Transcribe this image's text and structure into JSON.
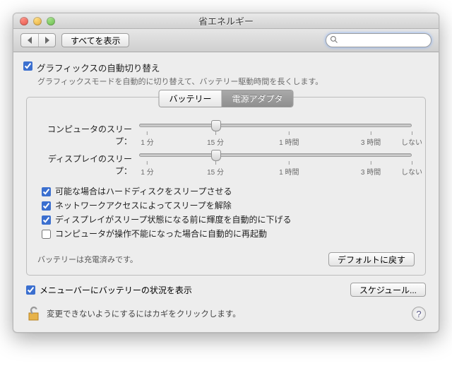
{
  "window": {
    "title": "省エネルギー"
  },
  "toolbar": {
    "show_all": "すべてを表示",
    "search_placeholder": ""
  },
  "graphics": {
    "checked": true,
    "title": "グラフィックスの自動切り替え",
    "subtitle": "グラフィックスモードを自動的に切り替えて、バッテリー駆動時間を長くします。"
  },
  "tabs": {
    "battery": "バッテリー",
    "power_adapter": "電源アダプタ",
    "active_index": 1
  },
  "sliders": {
    "computer": {
      "label": "コンピュータのスリープ：",
      "position_pct": 28
    },
    "display": {
      "label": "ディスプレイのスリープ：",
      "position_pct": 28
    },
    "ticks": [
      {
        "label": "1 分",
        "pct": 3
      },
      {
        "label": "15 分",
        "pct": 28
      },
      {
        "label": "1 時間",
        "pct": 55
      },
      {
        "label": "3 時間",
        "pct": 85
      },
      {
        "label": "しない",
        "pct": 100
      }
    ]
  },
  "options": {
    "hdd": {
      "checked": true,
      "label": "可能な場合はハードディスクをスリープさせる"
    },
    "network": {
      "checked": true,
      "label": "ネットワークアクセスによってスリープを解除"
    },
    "dim": {
      "checked": true,
      "label": "ディスプレイがスリープ状態になる前に輝度を自動的に下げる"
    },
    "restart": {
      "checked": false,
      "label": "コンピュータが操作不能になった場合に自動的に再起動"
    }
  },
  "status": {
    "battery": "バッテリーは充電済みです。"
  },
  "buttons": {
    "defaults": "デフォルトに戻す",
    "schedule": "スケジュール..."
  },
  "menubar": {
    "checked": true,
    "label": "メニューバーにバッテリーの状況を表示"
  },
  "lock": {
    "text": "変更できないようにするにはカギをクリックします。"
  }
}
